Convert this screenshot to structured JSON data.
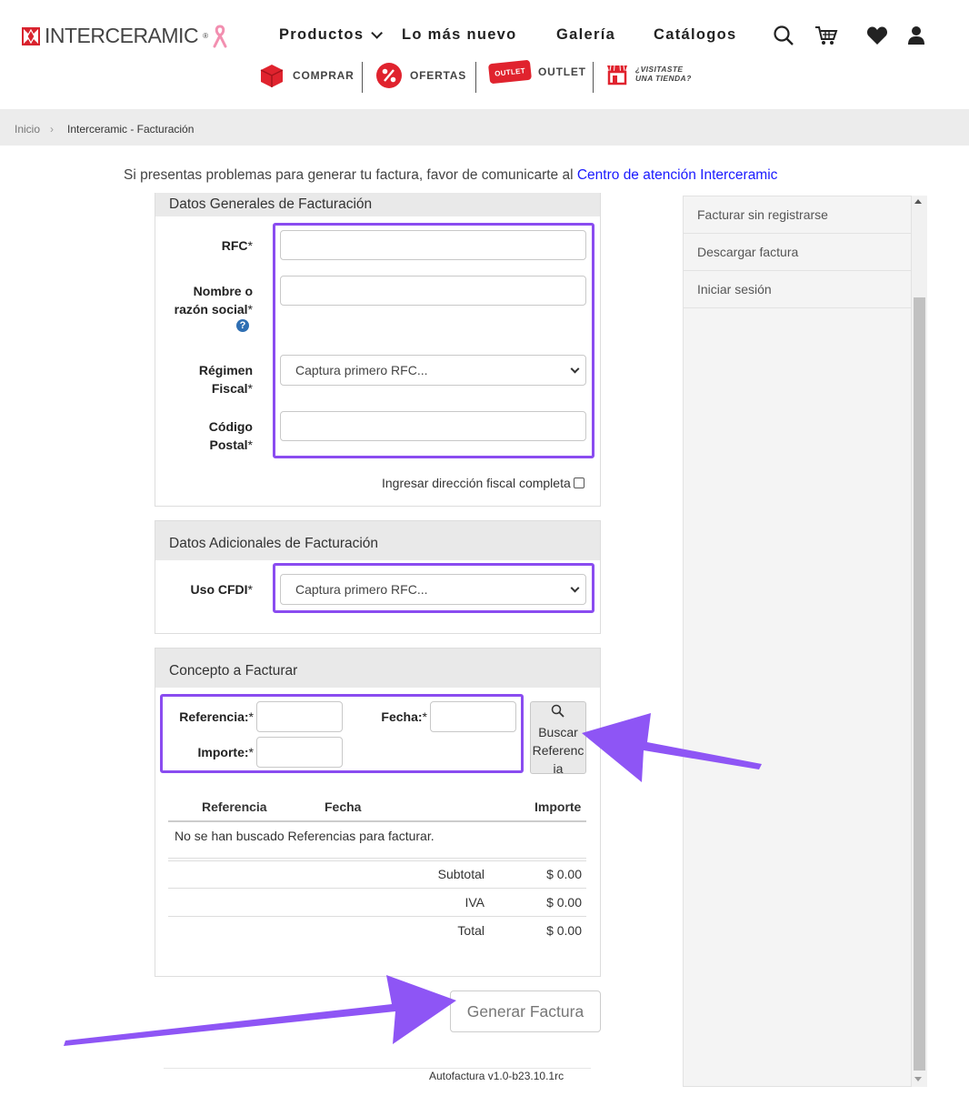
{
  "brand": {
    "name": "INTERCERAMIC",
    "reg": "®"
  },
  "nav": {
    "productos": "Productos",
    "nuevo": "Lo más nuevo",
    "galeria": "Galería",
    "catalogos": "Catálogos"
  },
  "subnav": {
    "comprar": "COMPRAR",
    "ofertas": "OFERTAS",
    "outlet": "OUTLET",
    "outlet_badge": "OUTLET",
    "visitaste_1": "¿VISITASTE",
    "visitaste_2": "UNA TIENDA?"
  },
  "breadcrumb": {
    "home": "Inicio",
    "current": "Interceramic - Facturación"
  },
  "notice": {
    "text": "Si presentas problemas para generar tu factura, favor de comunicarte al ",
    "link": "Centro de atención Interceramic"
  },
  "generales": {
    "title": "Datos Generales de Facturación",
    "rfc_label": "RFC",
    "rfc_value": "",
    "nombre_label_1": "Nombre o",
    "nombre_label_2": "razón social",
    "nombre_value": "",
    "regimen_label_1": "Régimen",
    "regimen_label_2": "Fiscal",
    "regimen_value": "Captura primero RFC...",
    "cp_label_1": "Código",
    "cp_label_2": "Postal",
    "cp_value": "",
    "direccion_check": "Ingresar dirección fiscal completa",
    "required_mark": "*"
  },
  "adicionales": {
    "title": "Datos Adicionales de Facturación",
    "uso_label": "Uso CFDI",
    "uso_value": "Captura primero RFC..."
  },
  "concepto": {
    "title": "Concepto a Facturar",
    "referencia_label": "Referencia:",
    "fecha_label": "Fecha:",
    "importe_label": "Importe:",
    "buscar_1": "Buscar",
    "buscar_2": "Referenc",
    "buscar_3": "ia",
    "table": {
      "headers": [
        "Referencia",
        "Fecha",
        "Importe"
      ],
      "empty": "No se han buscado Referencias para facturar.",
      "totals": [
        {
          "label": "Subtotal",
          "value": "$ 0.00"
        },
        {
          "label": "IVA",
          "value": "$ 0.00"
        },
        {
          "label": "Total",
          "value": "$ 0.00"
        }
      ]
    }
  },
  "generar": "Generar Factura",
  "version": "Autofactura v1.0-b23.10.1rc",
  "sidebar": {
    "items": [
      "Facturar sin registrarse",
      "Descargar factura",
      "Iniciar sesión"
    ]
  },
  "colors": {
    "highlight": "#8a4cf0",
    "link": "#1a1aff",
    "brand_red": "#e0232e"
  }
}
